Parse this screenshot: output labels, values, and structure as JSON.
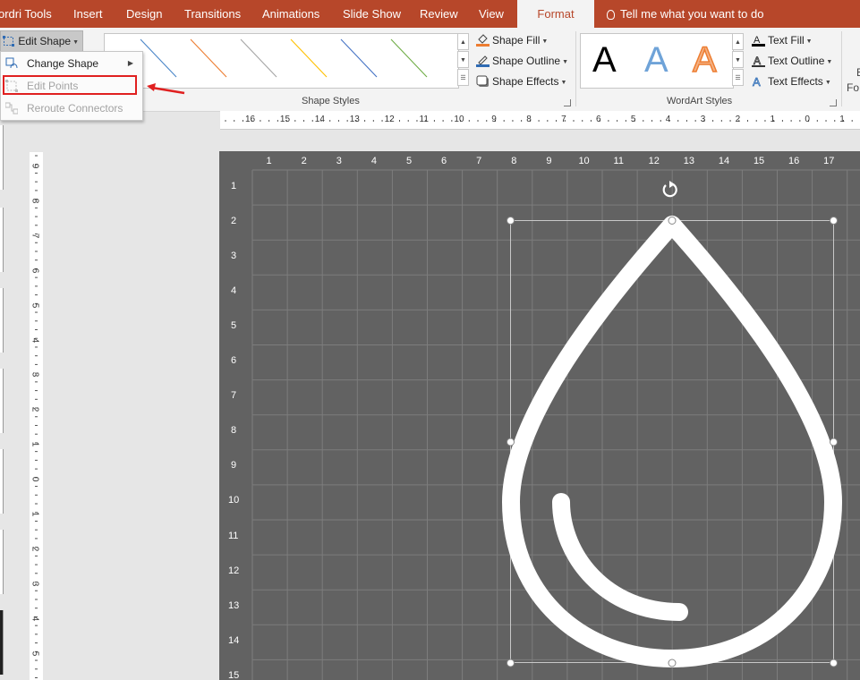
{
  "tabs": [
    {
      "label": "ordri Tools"
    },
    {
      "label": "Insert"
    },
    {
      "label": "Design"
    },
    {
      "label": "Transitions"
    },
    {
      "label": "Animations"
    },
    {
      "label": "Slide Show"
    },
    {
      "label": "Review"
    },
    {
      "label": "View"
    },
    {
      "label": "Format"
    }
  ],
  "tell_me": "Tell me what you want to do",
  "ribbon": {
    "edit_shape": "Edit Shape",
    "shape_styles_label": "Shape Styles",
    "wordart_styles_label": "WordArt Styles",
    "shape_fill": "Shape Fill",
    "shape_outline": "Shape Outline",
    "shape_effects": "Shape Effects",
    "text_fill": "Text Fill",
    "text_outline": "Text Outline",
    "text_effects": "Text Effects",
    "wordart_letter": "A",
    "cut_label_1": "E",
    "cut_label_2": "Fo",
    "line_colors": [
      "#000000",
      "#4a86c8",
      "#ed7d31",
      "#a5a5a5",
      "#ffc000",
      "#4472c4",
      "#70ad47"
    ]
  },
  "menu": {
    "items": [
      {
        "label": "Change Shape",
        "enabled": true
      },
      {
        "label": "Edit Points",
        "enabled": false
      },
      {
        "label": "Reroute Connectors",
        "enabled": false
      }
    ]
  },
  "hruler": {
    "labels": [
      "16",
      "15",
      "14",
      "13",
      "12",
      "11",
      "10",
      "9",
      "8",
      "7",
      "6",
      "5",
      "4",
      "3",
      "2",
      "1",
      "0",
      "1"
    ]
  },
  "vruler": {
    "labels": [
      "9",
      "8",
      "7",
      "6",
      "5",
      "4",
      "3",
      "2",
      "1",
      "0",
      "1",
      "2",
      "3",
      "4",
      "5"
    ]
  },
  "grid": {
    "columns": [
      "1",
      "2",
      "3",
      "4",
      "5",
      "6",
      "7",
      "8",
      "9",
      "10",
      "11",
      "12",
      "13",
      "14",
      "15",
      "16",
      "17"
    ],
    "rows": [
      "1",
      "2",
      "3",
      "4",
      "5",
      "6",
      "7",
      "8",
      "9",
      "10",
      "11",
      "12",
      "13",
      "14",
      "15"
    ]
  },
  "colors": {
    "accent": "#b7472a",
    "canvas": "#626262",
    "highlight": "#e02020"
  }
}
